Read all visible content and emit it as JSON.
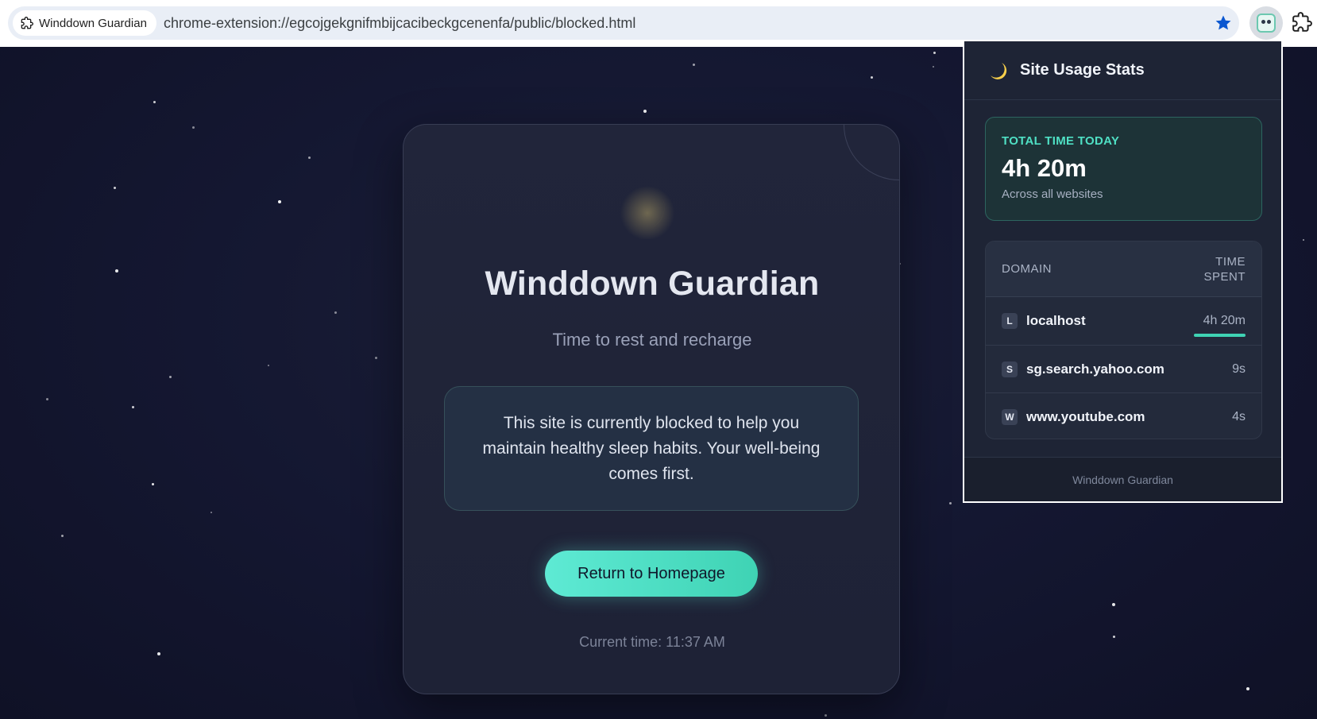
{
  "browser": {
    "site_chip_label": "Winddown Guardian",
    "url": "chrome-extension://egcojgekgnifmbijcacibeckgcenenfa/public/blocked.html",
    "bookmark_icon": "star-icon",
    "active_extension_icon": "robot-icon",
    "extensions_icon": "puzzle-icon"
  },
  "blocked_page": {
    "icon": "crescent-moon",
    "title": "Winddown Guardian",
    "subtitle": "Time to rest and recharge",
    "message": "This site is currently blocked to help you maintain healthy sleep habits. Your well-being comes first.",
    "button_label": "Return to Homepage",
    "current_time": "Current time: 11:37 AM"
  },
  "popup": {
    "title": "Site Usage Stats",
    "total": {
      "label": "TOTAL TIME TODAY",
      "value": "4h 20m",
      "sublabel": "Across all websites"
    },
    "table": {
      "col_domain": "DOMAIN",
      "col_time_line1": "TIME",
      "col_time_line2": "SPENT",
      "rows": [
        {
          "favicon": "L",
          "domain": "localhost",
          "time": "4h 20m",
          "share": 0.99
        },
        {
          "favicon": "S",
          "domain": "sg.search.yahoo.com",
          "time": "9s",
          "share": 0.0
        },
        {
          "favicon": "W",
          "domain": "www.youtube.com",
          "time": "4s",
          "share": 0.0
        }
      ]
    },
    "footer": "Winddown Guardian"
  },
  "colors": {
    "accent": "#5eead4",
    "background": "#141731",
    "card": "#21253a"
  }
}
